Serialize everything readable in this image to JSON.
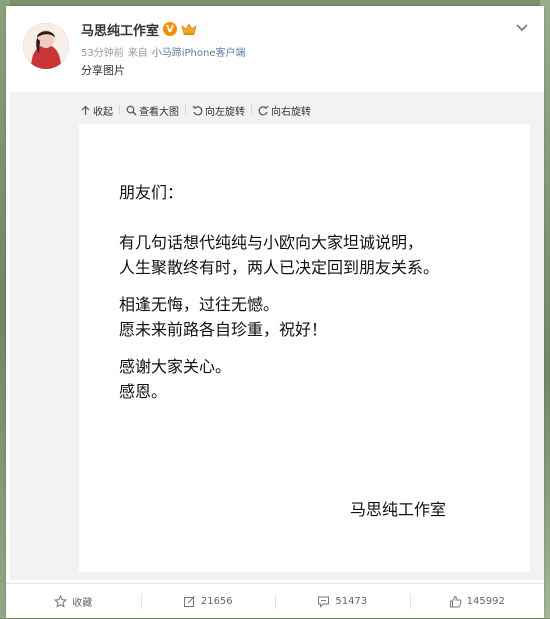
{
  "post": {
    "author": "马思纯工作室",
    "time": "53分钟前",
    "source_prefix": "来自",
    "source": "小马蹄iPhone客户端",
    "text": "分享图片",
    "verified_mark": "V"
  },
  "media_toolbar": {
    "collapse": "收起",
    "view_large": "查看大图",
    "rotate_left": "向左旋转",
    "rotate_right": "向右旋转"
  },
  "letter": {
    "greeting": "朋友们：",
    "para1_line1": "有几句话想代纯纯与小欧向大家坦诚说明，",
    "para1_line2": "人生聚散终有时，两人已决定回到朋友关系。",
    "para2_line1": "相逢无悔，过往无憾。",
    "para2_line2": "愿未来前路各自珍重，祝好！",
    "para3_line1": "感谢大家关心。",
    "para3_line2": "感恩。",
    "signature": "马思纯工作室"
  },
  "actions": {
    "favorite": "收藏",
    "repost": "21656",
    "comment": "51473",
    "like": "145992"
  },
  "colors": {
    "verified": "#ff8a00",
    "source_link": "#5b7fa6",
    "panel_bg": "#f2f2f2"
  }
}
